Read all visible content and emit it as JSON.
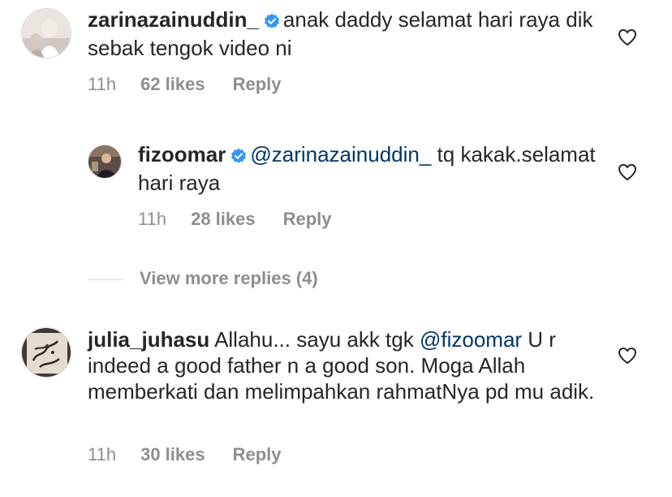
{
  "comments": [
    {
      "username": "zarinazainuddin_",
      "verified": true,
      "text": "anak daddy selamat hari raya dik sebak tengok video ni",
      "time": "11h",
      "likes": "62 likes",
      "reply": "Reply"
    },
    {
      "username": "fizoomar",
      "verified": true,
      "mention": "@zarinazainuddin_",
      "text": " tq kakak.selamat hari raya",
      "time": "11h",
      "likes": "28 likes",
      "reply": "Reply"
    },
    {
      "username": "julia_juhasu",
      "verified": false,
      "text_before": "Allahu... sayu akk tgk ",
      "mention": "@fizoomar",
      "text_after": " U r indeed a good father n a good son. Moga Allah memberkati dan melimpahkan rahmatNya pd mu adik.",
      "time": "11h",
      "likes": "30 likes",
      "reply": "Reply"
    }
  ],
  "view_more_replies": "View more replies (4)",
  "colors": {
    "text": "#262626",
    "meta": "#8e8e8e",
    "mention": "#003569",
    "verified": "#3897f0"
  },
  "icons": {
    "like": "heart-outline-icon",
    "verified": "verified-badge-icon"
  }
}
